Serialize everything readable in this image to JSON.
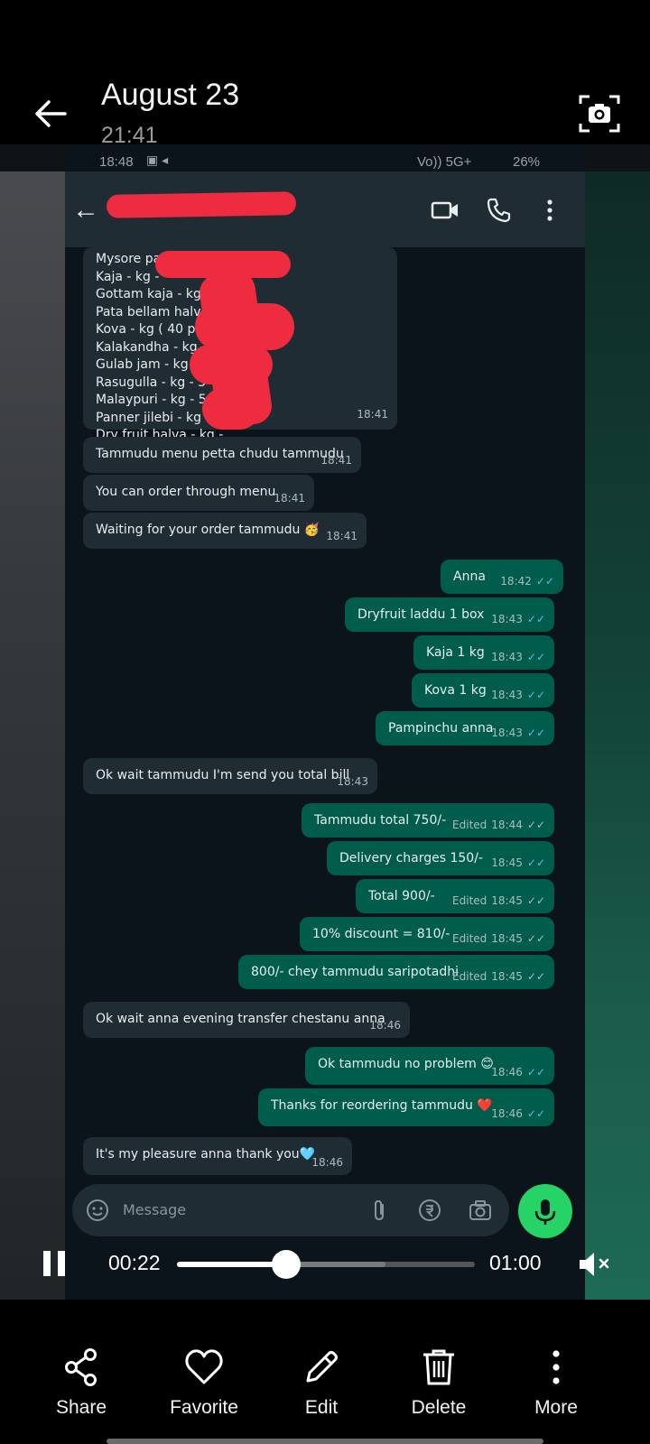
{
  "gallery": {
    "date": "August 23",
    "time": "21:41"
  },
  "statusbar": {
    "time": "18:48",
    "network": "Vo)) 5G+",
    "battery": "26%"
  },
  "menu_items": [
    "Mysore pa...",
    "Kaja - kg -",
    "Gottam kaja - kg - 2",
    "Pata bellam halva - kg",
    "Kova - kg ( 40 piec",
    "Kalakandha - kg",
    "Gulab jam - kg -",
    "Rasugulla - kg - 3",
    "Malaypuri - kg - 5",
    "Panner jilebi - kg -",
    "Dry fruit halva - kg -"
  ],
  "menu_time": "18:41",
  "messages": [
    {
      "dir": "in",
      "text": "Tammudu menu petta chudu tammudu",
      "time": "18:41"
    },
    {
      "dir": "in",
      "text": "You can order through menu",
      "time": "18:41"
    },
    {
      "dir": "in",
      "text": "Waiting for your order tammudu 🥳",
      "time": "18:41"
    },
    {
      "dir": "out",
      "text": "Anna",
      "time": "18:42",
      "tick": "read"
    },
    {
      "dir": "out",
      "text": "Dryfruit laddu  1 box",
      "time": "18:43",
      "tick": "read"
    },
    {
      "dir": "out",
      "text": "Kaja 1 kg",
      "time": "18:43",
      "tick": "read"
    },
    {
      "dir": "out",
      "text": "Kova 1 kg",
      "time": "18:43",
      "tick": "read"
    },
    {
      "dir": "out",
      "text": "Pampinchu anna",
      "time": "18:43",
      "tick": "read"
    },
    {
      "dir": "in",
      "text": "Ok wait tammudu I'm send you total bill",
      "time": "18:43"
    },
    {
      "dir": "out",
      "text": "Tammudu total 750/-",
      "time": "18:44",
      "edited": "Edited",
      "tick": "delivered"
    },
    {
      "dir": "out",
      "text": "Delivery charges 150/-",
      "time": "18:45",
      "tick": "read"
    },
    {
      "dir": "out",
      "text": "Total 900/-",
      "time": "18:45",
      "edited": "Edited",
      "tick": "delivered"
    },
    {
      "dir": "out",
      "text": "10% discount = 810/-",
      "time": "18:45",
      "edited": "Edited",
      "tick": "delivered"
    },
    {
      "dir": "out",
      "text": "800/- chey tammudu saripotadhi",
      "time": "18:45",
      "edited": "Edited",
      "tick": "delivered"
    },
    {
      "dir": "in",
      "text": "Ok wait anna evening transfer chestanu anna",
      "time": "18:46"
    },
    {
      "dir": "out",
      "text": "Ok tammudu no problem 😊",
      "time": "18:46",
      "tick": "read"
    },
    {
      "dir": "out",
      "text": "Thanks for reordering tammudu ❤️",
      "time": "18:46",
      "tick": "read"
    },
    {
      "dir": "in",
      "text": "It's my pleasure anna thank you🩵",
      "time": "18:46"
    }
  ],
  "tick_glyph": "✓✓",
  "composer": {
    "placeholder": "Message"
  },
  "player": {
    "current": "00:22",
    "total": "01:00",
    "progress": 0.367,
    "buffered": 0.7
  },
  "actions": [
    {
      "label": "Share",
      "icon": "share-icon"
    },
    {
      "label": "Favorite",
      "icon": "heart-icon"
    },
    {
      "label": "Edit",
      "icon": "pencil-icon"
    },
    {
      "label": "Delete",
      "icon": "trash-icon"
    },
    {
      "label": "More",
      "icon": "more-vertical-icon"
    }
  ],
  "colors": {
    "incoming_bubble": "#1f2c33",
    "outgoing_bubble": "#005c4b",
    "read_tick": "#53bdeb",
    "mic_button": "#25d366",
    "redaction": "#ee2b3f"
  }
}
